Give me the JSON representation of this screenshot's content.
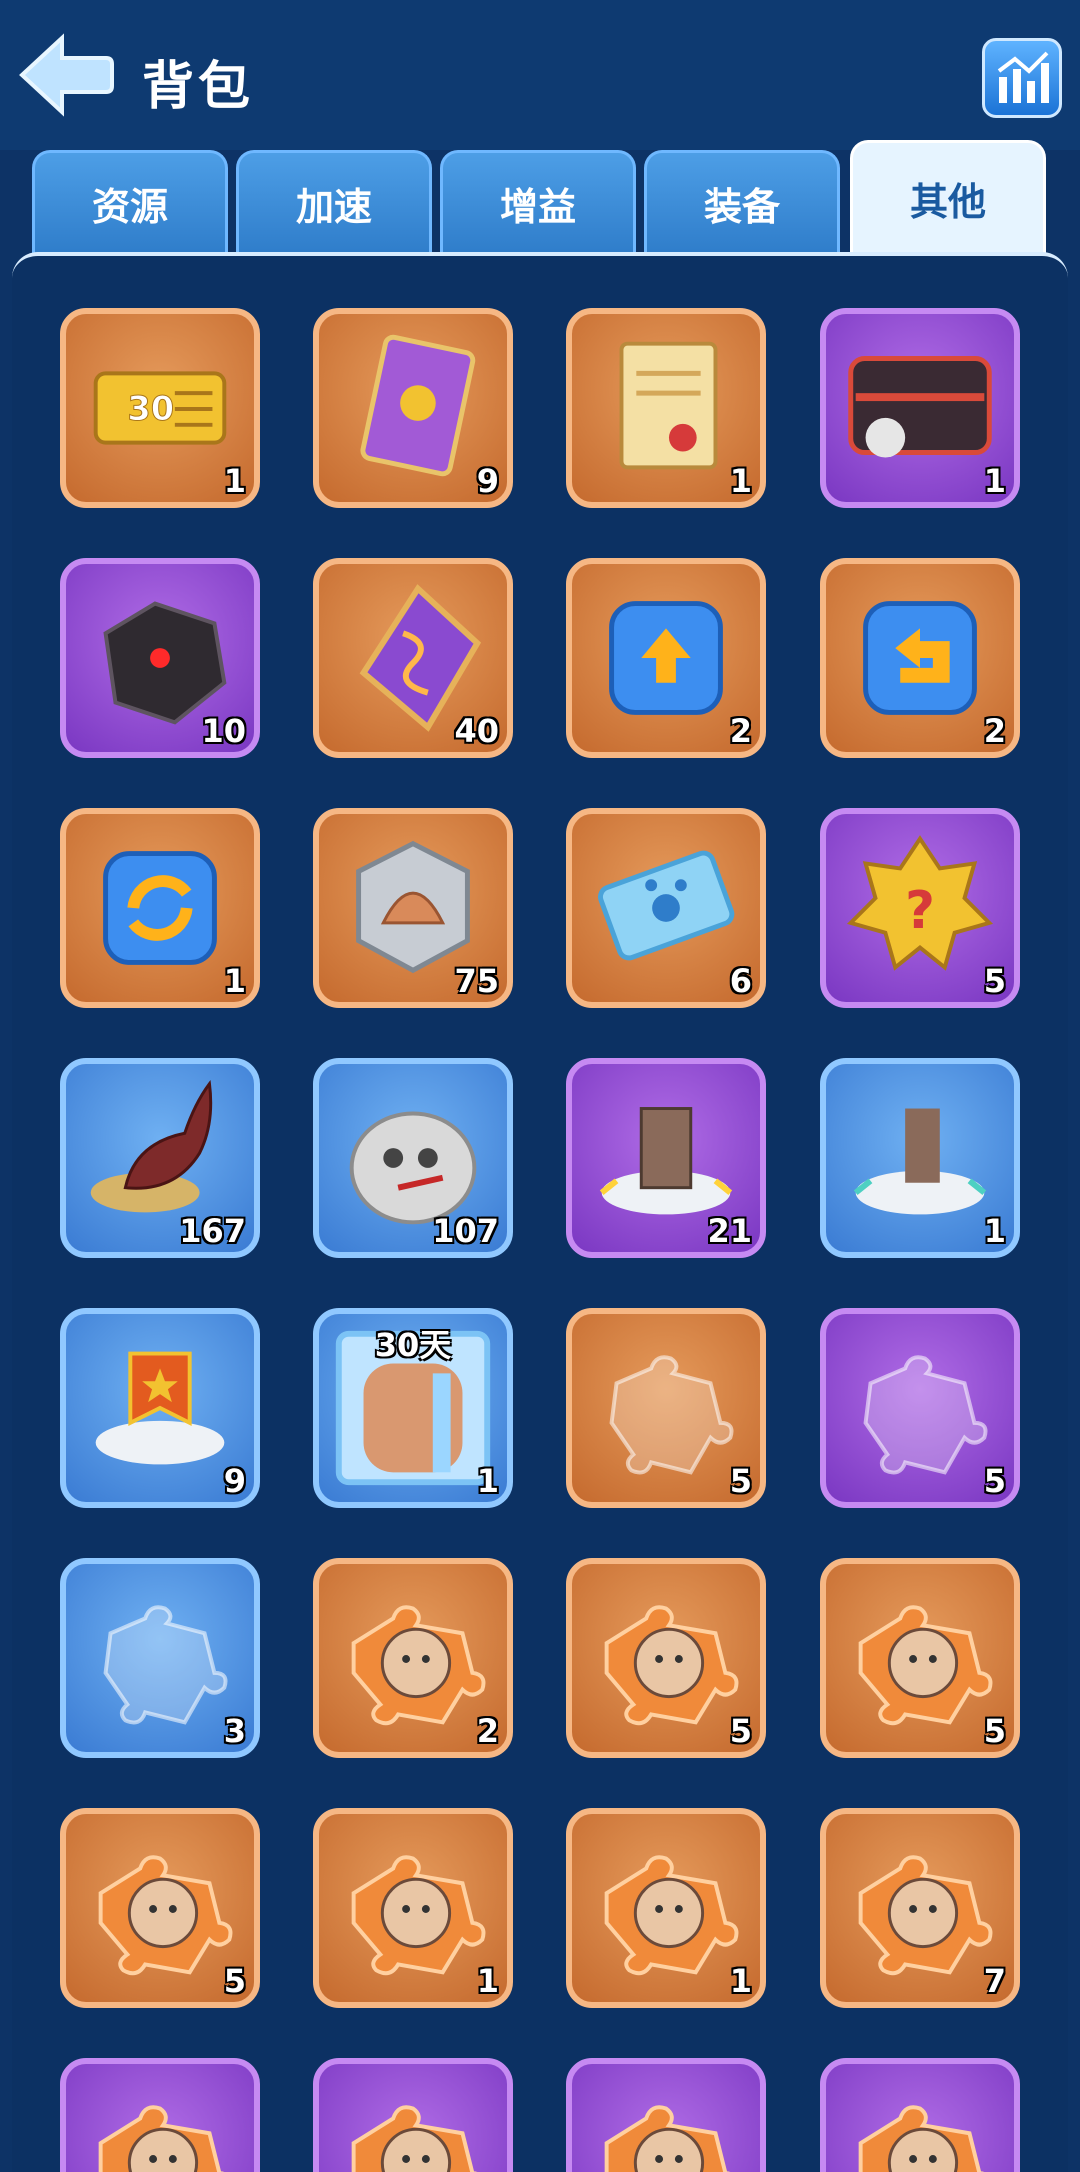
{
  "header": {
    "title": "背包",
    "back_icon": "back-arrow-icon",
    "stats_icon": "bar-chart-icon"
  },
  "tabs": [
    {
      "label": "资源",
      "active": false
    },
    {
      "label": "加速",
      "active": false
    },
    {
      "label": "增益",
      "active": false
    },
    {
      "label": "装备",
      "active": false
    },
    {
      "label": "其他",
      "active": true
    }
  ],
  "items": [
    {
      "icon": "ticket-30-icon",
      "rarity": "orange",
      "count": "1"
    },
    {
      "icon": "purple-card-icon",
      "rarity": "orange",
      "count": "9"
    },
    {
      "icon": "scroll-icon",
      "rarity": "orange",
      "count": "1"
    },
    {
      "icon": "treasure-chest-icon",
      "rarity": "purple",
      "count": "1"
    },
    {
      "icon": "dark-ore-icon",
      "rarity": "purple",
      "count": "10"
    },
    {
      "icon": "rune-stone-icon",
      "rarity": "orange",
      "count": "40"
    },
    {
      "icon": "upload-token-icon",
      "rarity": "orange",
      "count": "2"
    },
    {
      "icon": "return-token-icon",
      "rarity": "orange",
      "count": "2"
    },
    {
      "icon": "swap-token-icon",
      "rarity": "orange",
      "count": "1"
    },
    {
      "icon": "shell-coin-icon",
      "rarity": "orange",
      "count": "75"
    },
    {
      "icon": "paw-ticket-icon",
      "rarity": "orange",
      "count": "6"
    },
    {
      "icon": "mystery-badge-icon",
      "rarity": "purple",
      "count": "5"
    },
    {
      "icon": "horn-icon",
      "rarity": "blue",
      "count": "167"
    },
    {
      "icon": "sack-icon",
      "rarity": "blue",
      "count": "107"
    },
    {
      "icon": "building-move-icon",
      "rarity": "purple",
      "count": "21"
    },
    {
      "icon": "statue-move-icon",
      "rarity": "blue",
      "count": "1"
    },
    {
      "icon": "banner-move-icon",
      "rarity": "blue",
      "count": "9"
    },
    {
      "icon": "ice-frame-icon",
      "rarity": "blue",
      "count": "1",
      "label": "30天"
    },
    {
      "icon": "puzzle-piece-icon",
      "rarity": "orange",
      "count": "5"
    },
    {
      "icon": "puzzle-piece-icon",
      "rarity": "purple",
      "count": "5"
    },
    {
      "icon": "puzzle-piece-icon",
      "rarity": "blue",
      "count": "3"
    },
    {
      "icon": "hero-puzzle-icon",
      "rarity": "orange",
      "count": "2"
    },
    {
      "icon": "hero-puzzle-icon",
      "rarity": "orange",
      "count": "5"
    },
    {
      "icon": "hero-puzzle-icon",
      "rarity": "orange",
      "count": "5"
    },
    {
      "icon": "hero-puzzle-icon",
      "rarity": "orange",
      "count": "5"
    },
    {
      "icon": "hero-puzzle-icon",
      "rarity": "orange",
      "count": "1"
    },
    {
      "icon": "hero-puzzle-icon",
      "rarity": "orange",
      "count": "1"
    },
    {
      "icon": "hero-puzzle-icon",
      "rarity": "orange",
      "count": "7"
    },
    {
      "icon": "hero-puzzle-icon",
      "rarity": "purple",
      "count": ""
    },
    {
      "icon": "hero-puzzle-icon",
      "rarity": "purple",
      "count": ""
    },
    {
      "icon": "hero-puzzle-icon",
      "rarity": "purple",
      "count": ""
    },
    {
      "icon": "hero-puzzle-icon",
      "rarity": "purple",
      "count": ""
    }
  ]
}
